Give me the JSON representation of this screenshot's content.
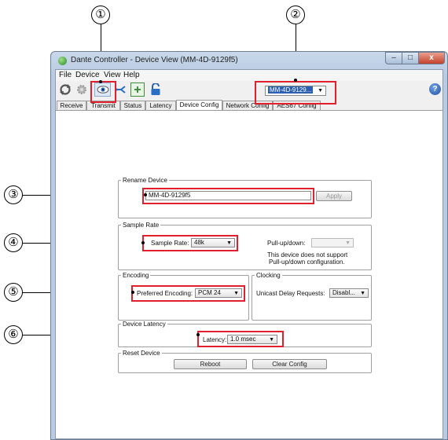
{
  "window": {
    "title": "Dante Controller - Device View (MM-4D-9129f5)",
    "controls": {
      "minimize": "–",
      "maximize": "□",
      "close": "x"
    }
  },
  "menu": [
    "File",
    "Device",
    "View",
    "Help"
  ],
  "toolbar": {
    "device_select": "MM-4D-9129...",
    "icons": [
      "refresh-icon",
      "settings-icon",
      "eye-icon",
      "connect-icon",
      "add-icon",
      "lock-icon",
      "help-icon"
    ],
    "help_label": "?"
  },
  "tabs": [
    "Receive",
    "Transmit",
    "Status",
    "Latency",
    "Device Config",
    "Network Config",
    "AES67 Config"
  ],
  "rename_device": {
    "legend": "Rename Device",
    "value": "MM-4D-9129f5",
    "apply": "Apply"
  },
  "sample_rate": {
    "legend": "Sample Rate",
    "label": "Sample Rate:",
    "value": "48k",
    "pullup_label": "Pull-up/down:",
    "pullup_value": "",
    "note_line1": "This device does not support",
    "note_line2": "Pull-up/down configuration."
  },
  "encoding": {
    "legend": "Encoding",
    "label": "Preferred Encoding:",
    "value": "PCM 24"
  },
  "clocking": {
    "legend": "Clocking",
    "label": "Unicast Delay Requests:",
    "value": "Disabl..."
  },
  "latency": {
    "legend": "Device Latency",
    "label": "Latency:",
    "value": "1.0 msec"
  },
  "reset": {
    "legend": "Reset Device",
    "reboot": "Reboot",
    "clear": "Clear Config"
  },
  "callouts": [
    "①",
    "②",
    "③",
    "④",
    "⑤",
    "⑥"
  ]
}
